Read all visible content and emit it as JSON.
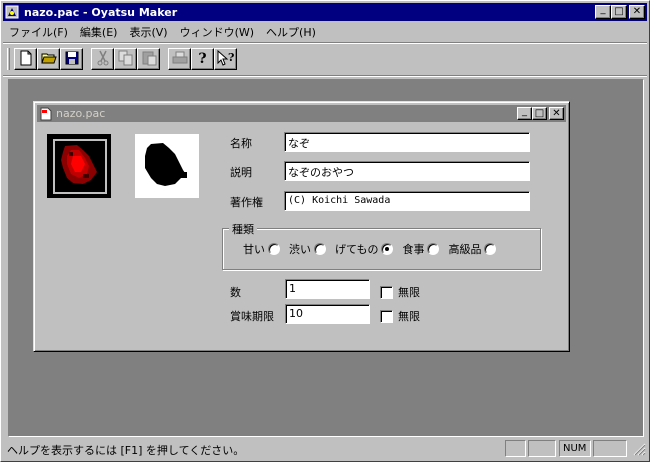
{
  "window": {
    "title": "nazo.pac - Oyatsu Maker",
    "minimize_glyph": "_",
    "maximize_glyph": "□",
    "close_glyph": "✕"
  },
  "menu": [
    "ファイル(F)",
    "編集(E)",
    "表示(V)",
    "ウィンドウ(W)",
    "ヘルプ(H)"
  ],
  "toolbar": {
    "icons": [
      "new-file-icon",
      "open-folder-icon",
      "save-icon",
      "cut-icon",
      "copy-icon",
      "paste-icon",
      "print-icon",
      "help-icon",
      "context-help-icon"
    ]
  },
  "child": {
    "title": "nazo.pac",
    "fields": {
      "name_label": "名称",
      "name_value": "なぞ",
      "desc_label": "説明",
      "desc_value": "なぞのおやつ",
      "author_label": "著作権",
      "author_value": "(C) Koichi Sawada"
    },
    "category": {
      "legend": "種類",
      "options": [
        {
          "label": "甘い",
          "checked": false
        },
        {
          "label": "渋い",
          "checked": false
        },
        {
          "label": "げてもの",
          "checked": true
        },
        {
          "label": "食事",
          "checked": false
        },
        {
          "label": "高級品",
          "checked": false
        }
      ]
    },
    "quantity": {
      "label": "数",
      "value": "1",
      "unlimited_label": "無限",
      "unlimited_checked": false
    },
    "expiry": {
      "label": "賞味期限",
      "value": "10",
      "unlimited_label": "無限",
      "unlimited_checked": false
    }
  },
  "status": {
    "help_text": "ヘルプを表示するには [F1] を押してください。",
    "num_indicator": "NUM"
  },
  "colors": {
    "title_active": "#000080",
    "title_inactive": "#808080",
    "face": "#c0c0c0",
    "mdi_background": "#808080"
  }
}
